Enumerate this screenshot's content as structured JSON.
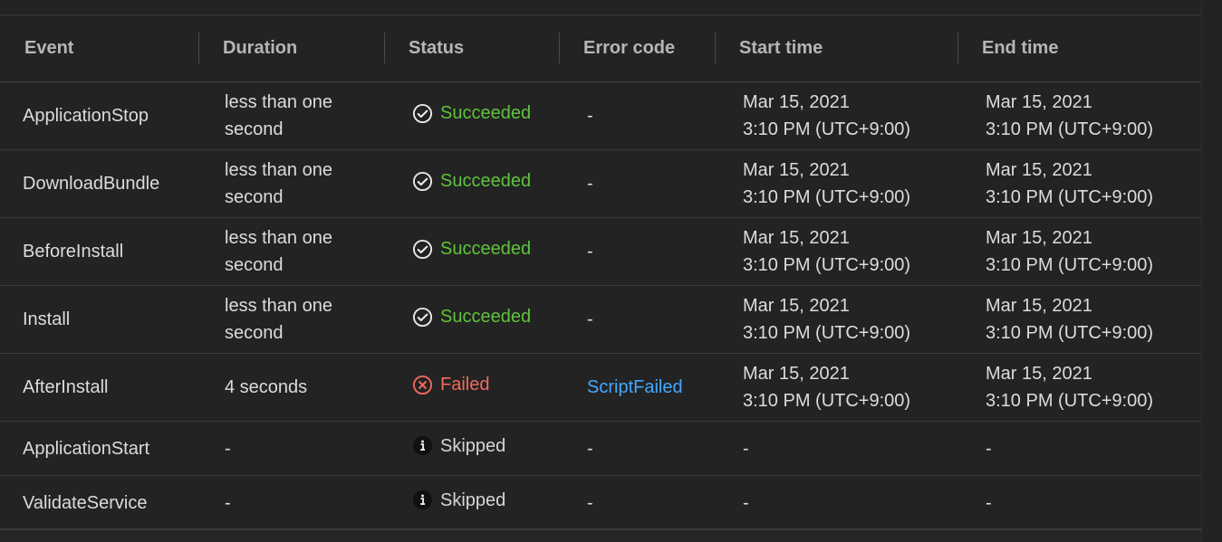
{
  "table": {
    "headers": [
      "Event",
      "Duration",
      "Status",
      "Error code",
      "Start time",
      "End time"
    ],
    "rows": [
      {
        "event": "ApplicationStop",
        "duration_1": "less than one",
        "duration_2": "second",
        "status": "Succeeded",
        "error": "-",
        "start_1": "Mar 15, 2021",
        "start_2": "3:10 PM (UTC+9:00)",
        "end_1": "Mar 15, 2021",
        "end_2": "3:10 PM (UTC+9:00)"
      },
      {
        "event": "DownloadBundle",
        "duration_1": "less than one",
        "duration_2": "second",
        "status": "Succeeded",
        "error": "-",
        "start_1": "Mar 15, 2021",
        "start_2": "3:10 PM (UTC+9:00)",
        "end_1": "Mar 15, 2021",
        "end_2": "3:10 PM (UTC+9:00)"
      },
      {
        "event": "BeforeInstall",
        "duration_1": "less than one",
        "duration_2": "second",
        "status": "Succeeded",
        "error": "-",
        "start_1": "Mar 15, 2021",
        "start_2": "3:10 PM (UTC+9:00)",
        "end_1": "Mar 15, 2021",
        "end_2": "3:10 PM (UTC+9:00)"
      },
      {
        "event": "Install",
        "duration_1": "less than one",
        "duration_2": "second",
        "status": "Succeeded",
        "error": "-",
        "start_1": "Mar 15, 2021",
        "start_2": "3:10 PM (UTC+9:00)",
        "end_1": "Mar 15, 2021",
        "end_2": "3:10 PM (UTC+9:00)"
      },
      {
        "event": "AfterInstall",
        "duration_1": "4 seconds",
        "duration_2": "",
        "status": "Failed",
        "error": "ScriptFailed",
        "start_1": "Mar 15, 2021",
        "start_2": "3:10 PM (UTC+9:00)",
        "end_1": "Mar 15, 2021",
        "end_2": "3:10 PM (UTC+9:00)"
      },
      {
        "event": "ApplicationStart",
        "duration_1": "-",
        "duration_2": "",
        "status": "Skipped",
        "error": "-",
        "start_1": "-",
        "start_2": "",
        "end_1": "-",
        "end_2": ""
      },
      {
        "event": "ValidateService",
        "duration_1": "-",
        "duration_2": "",
        "status": "Skipped",
        "error": "-",
        "start_1": "-",
        "start_2": "",
        "end_1": "-",
        "end_2": ""
      }
    ]
  },
  "icons": {
    "succeeded": "check-circle-icon",
    "failed": "x-circle-icon",
    "skipped": "info-circle-icon"
  },
  "colors": {
    "succeeded": "#5fc33b",
    "failed": "#f06a5d",
    "link": "#43a8ff"
  }
}
